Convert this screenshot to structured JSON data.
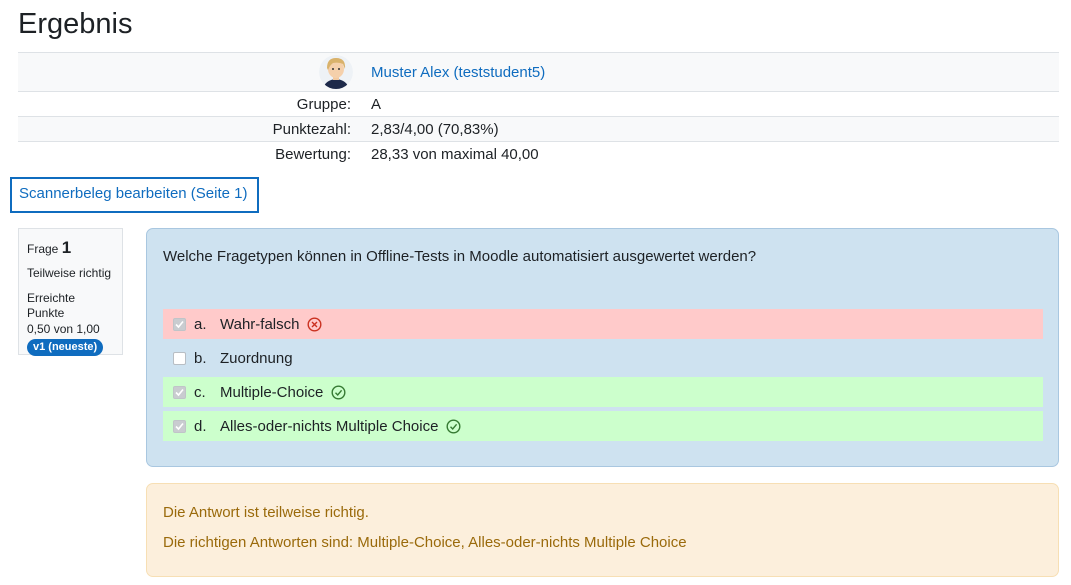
{
  "page": {
    "title": "Ergebnis"
  },
  "summary": {
    "user_name": "Muster Alex (teststudent5)",
    "rows": [
      {
        "label": "Gruppe:",
        "value": "A"
      },
      {
        "label": "Punktezahl:",
        "value": "2,83/4,00 (70,83%)"
      },
      {
        "label": "Bewertung:",
        "value": "28,33 von maximal 40,00"
      }
    ]
  },
  "scanner_link": "Scannerbeleg bearbeiten (Seite 1)",
  "question_info": {
    "label": "Frage",
    "number": "1",
    "state": "Teilweise richtig",
    "grade_label": "Erreichte Punkte",
    "grade_value": "0,50 von 1,00",
    "version_badge": "v1 (neueste)"
  },
  "question": {
    "text": "Welche Fragetypen können in Offline-Tests in Moodle automatisiert ausgewertet werden?",
    "answers": [
      {
        "letter": "a.",
        "label": "Wahr-falsch",
        "checked": true,
        "status": "incorrect",
        "icon": "cross-circle-icon"
      },
      {
        "letter": "b.",
        "label": "Zuordnung",
        "checked": false,
        "status": "none",
        "icon": ""
      },
      {
        "letter": "c.",
        "label": "Multiple-Choice",
        "checked": true,
        "status": "correct",
        "icon": "check-circle-icon"
      },
      {
        "letter": "d.",
        "label": "Alles-oder-nichts Multiple Choice",
        "checked": true,
        "status": "correct",
        "icon": "check-circle-icon"
      }
    ]
  },
  "feedback": {
    "partial": "Die Antwort ist teilweise richtig.",
    "right_answer": "Die richtigen Antworten sind: Multiple-Choice, Alles-oder-nichts Multiple Choice"
  },
  "colors": {
    "link": "#0f6cbf",
    "incorrect_bg": "#ffcaca",
    "correct_bg": "#ccffcc",
    "question_bg": "#cee2f0",
    "feedback_bg": "#fcefdc",
    "feedback_text": "#9a6a0b",
    "incorrect_icon": "#ca3120",
    "correct_icon": "#357a32"
  }
}
